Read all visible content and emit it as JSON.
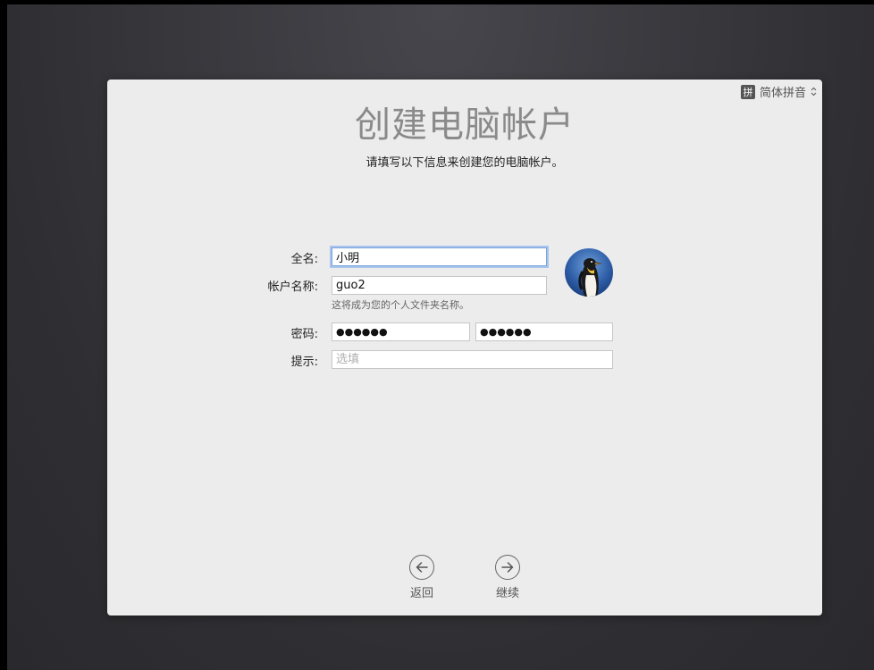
{
  "input_source": {
    "badge": "拼",
    "label": "简体拼音"
  },
  "page": {
    "title": "创建电脑帐户",
    "subtitle": "请填写以下信息来创建您的电脑帐户。"
  },
  "form": {
    "full_name_label": "全名:",
    "full_name_value": "小明",
    "account_name_label": "帐户名称:",
    "account_name_value": "guo2",
    "account_name_hint": "这将成为您的个人文件夹名称。",
    "password_label": "密码:",
    "password_value": "●●●●●●",
    "password_verify_value": "●●●●●●",
    "hint_label": "提示:",
    "hint_placeholder": "选填"
  },
  "avatar": {
    "icon": "penguin-icon"
  },
  "nav": {
    "back_label": "返回",
    "continue_label": "继续"
  }
}
